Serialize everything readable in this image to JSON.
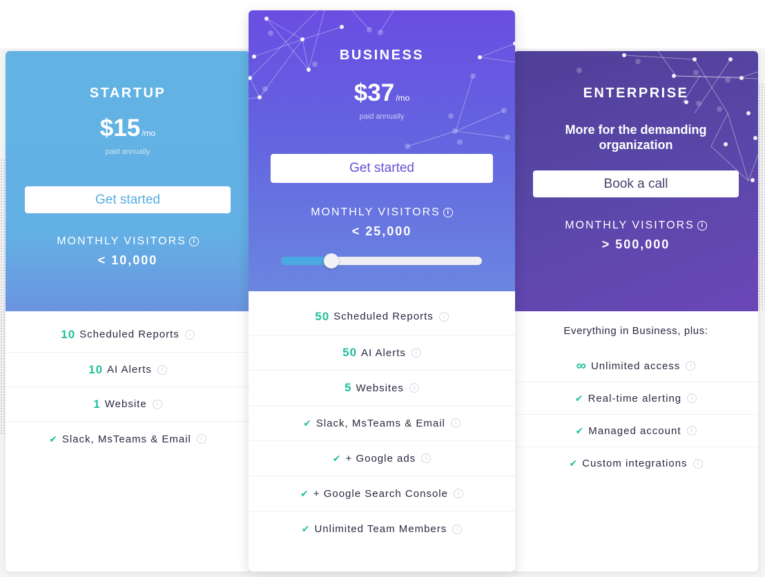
{
  "plans": [
    {
      "id": "startup",
      "name": "STARTUP",
      "price": "$15",
      "price_unit": "/mo",
      "billing_note": "paid annually",
      "cta_label": "Get started",
      "visitors_label": "MONTHLY VISITORS",
      "visitors_value": "< 10,000",
      "features": [
        {
          "prefix": "10",
          "text": "Scheduled Reports",
          "icon": "number"
        },
        {
          "prefix": "10",
          "text": "AI Alerts",
          "icon": "number"
        },
        {
          "prefix": "1",
          "text": "Website",
          "icon": "number"
        },
        {
          "prefix": "✔",
          "text": "Slack, MsTeams & Email",
          "icon": "check-icon"
        }
      ]
    },
    {
      "id": "business",
      "name": "BUSINESS",
      "price": "$37",
      "price_unit": "/mo",
      "billing_note": "paid annually",
      "cta_label": "Get started",
      "visitors_label": "MONTHLY VISITORS",
      "visitors_value": "< 25,000",
      "visitors_slider_fraction": 0.25,
      "features": [
        {
          "prefix": "50",
          "text": "Scheduled Reports",
          "icon": "number"
        },
        {
          "prefix": "50",
          "text": "AI Alerts",
          "icon": "number"
        },
        {
          "prefix": "5",
          "text": "Websites",
          "icon": "number"
        },
        {
          "prefix": "✔",
          "text": "Slack, MsTeams & Email",
          "icon": "check-icon"
        },
        {
          "prefix": "✔",
          "text": "+ Google ads",
          "icon": "check-icon"
        },
        {
          "prefix": "✔",
          "text": "+ Google Search Console",
          "icon": "check-icon"
        },
        {
          "prefix": "✔",
          "text": "Unlimited Team Members",
          "icon": "check-icon"
        }
      ]
    },
    {
      "id": "enterprise",
      "name": "ENTERPRISE",
      "tagline_line1": "More for the demanding",
      "tagline_line2": "organization",
      "cta_label": "Book a call",
      "visitors_label": "MONTHLY VISITORS",
      "visitors_value": "> 500,000",
      "features_intro": "Everything in Business, plus:",
      "features": [
        {
          "prefix": "∞",
          "text": "Unlimited access",
          "icon": "infinity-icon"
        },
        {
          "prefix": "✔",
          "text": "Real-time alerting",
          "icon": "check-icon"
        },
        {
          "prefix": "✔",
          "text": "Managed account",
          "icon": "check-icon"
        },
        {
          "prefix": "✔",
          "text": "Custom integrations",
          "icon": "check-icon"
        }
      ]
    }
  ],
  "info_icon_glyph": "i",
  "colors": {
    "accent_green": "#22bf9b",
    "startup_blue": "#62b3e4",
    "business_purple": "#6a4de2",
    "enterprise_purple": "#5947a8"
  }
}
